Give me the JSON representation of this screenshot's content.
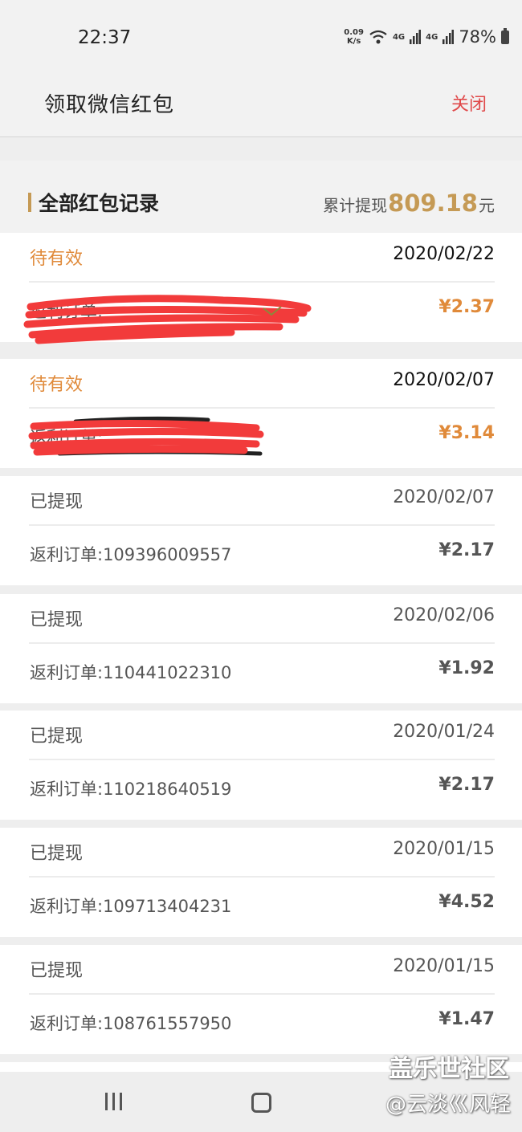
{
  "status_bar": {
    "time": "22:37",
    "net_speed_value": "0.09",
    "net_speed_unit": "K/s",
    "network_1": "4G",
    "network_2": "4G",
    "battery": "78%"
  },
  "header": {
    "title": "领取微信红包",
    "close_label": "关闭"
  },
  "summary": {
    "title": "全部红包记录",
    "total_prefix": "累计提现",
    "total_amount": "809.18",
    "total_suffix": "元"
  },
  "records": [
    {
      "status": "待有效",
      "date": "2020/02/22",
      "order": "返利订单:",
      "amount": "¥2.37",
      "state": "pending"
    },
    {
      "status": "待有效",
      "date": "2020/02/07",
      "order": "返利订单:",
      "amount": "¥3.14",
      "state": "pending"
    },
    {
      "status": "已提现",
      "date": "2020/02/07",
      "order": "返利订单:109396009557",
      "amount": "¥2.17",
      "state": "done"
    },
    {
      "status": "已提现",
      "date": "2020/02/06",
      "order": "返利订单:110441022310",
      "amount": "¥1.92",
      "state": "done"
    },
    {
      "status": "已提现",
      "date": "2020/01/24",
      "order": "返利订单:110218640519",
      "amount": "¥2.17",
      "state": "done"
    },
    {
      "status": "已提现",
      "date": "2020/01/15",
      "order": "返利订单:109713404231",
      "amount": "¥4.52",
      "state": "done"
    },
    {
      "status": "已提现",
      "date": "2020/01/15",
      "order": "返利订单:108761557950",
      "amount": "¥1.47",
      "state": "done"
    }
  ],
  "watermark": {
    "line1": "盖乐世社区",
    "line2": "@云淡巛风轻"
  },
  "colors": {
    "pending": "#e08a3a",
    "accent_gold": "#c59a55",
    "close_red": "#e0494a"
  }
}
